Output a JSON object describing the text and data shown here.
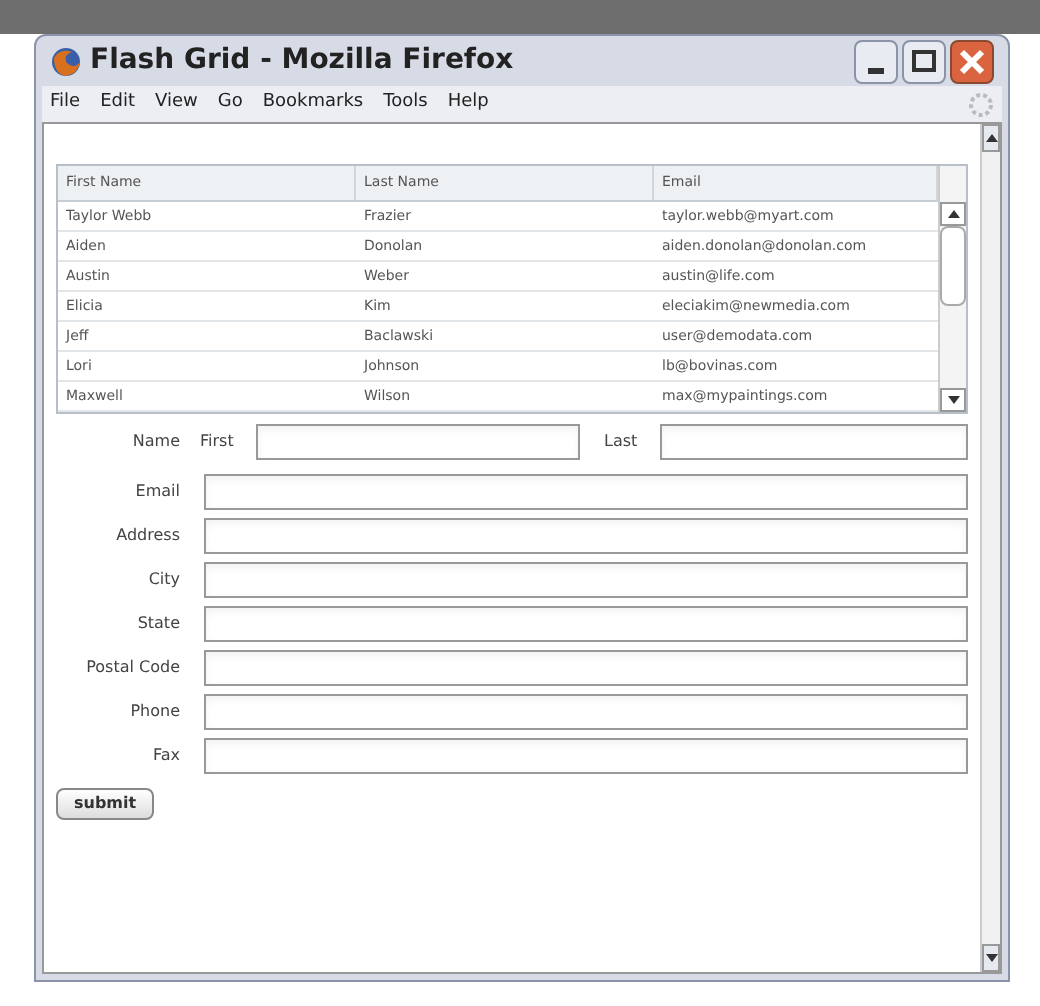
{
  "window": {
    "title": "Flash Grid - Mozilla Firefox"
  },
  "menu": [
    "File",
    "Edit",
    "View",
    "Go",
    "Bookmarks",
    "Tools",
    "Help"
  ],
  "grid": {
    "columns": [
      "First Name",
      "Last Name",
      "Email"
    ],
    "rows": [
      [
        "Taylor Webb",
        "Frazier",
        "taylor.webb@myart.com"
      ],
      [
        "Aiden",
        "Donolan",
        "aiden.donolan@donolan.com"
      ],
      [
        "Austin",
        "Weber",
        "austin@life.com"
      ],
      [
        "Elicia",
        "Kim",
        "eleciakim@newmedia.com"
      ],
      [
        "Jeff",
        "Baclawski",
        "user@demodata.com"
      ],
      [
        "Lori",
        "Johnson",
        "lb@bovinas.com"
      ],
      [
        "Maxwell",
        "Wilson",
        "max@mypaintings.com"
      ]
    ]
  },
  "form": {
    "name_label": "Name",
    "first_label": "First",
    "last_label": "Last",
    "fields": [
      {
        "label": "Email"
      },
      {
        "label": "Address"
      },
      {
        "label": "City"
      },
      {
        "label": "State"
      },
      {
        "label": "Postal Code"
      },
      {
        "label": "Phone"
      },
      {
        "label": "Fax"
      }
    ],
    "submit": "submit"
  }
}
